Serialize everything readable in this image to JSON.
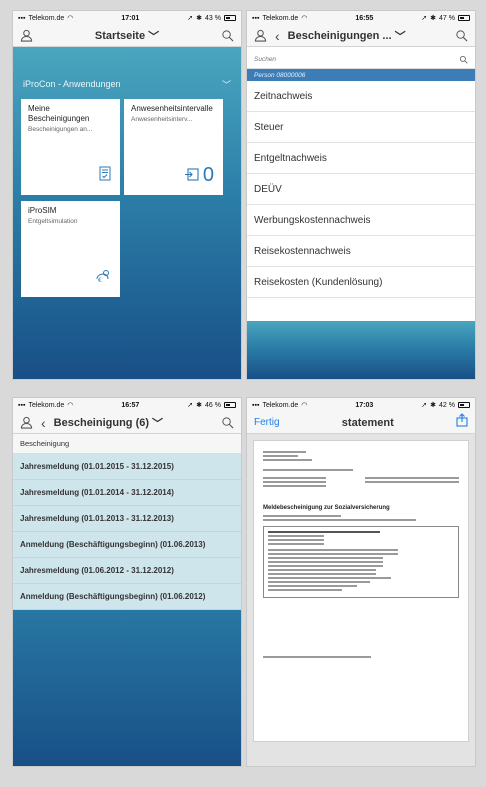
{
  "screens": [
    {
      "status": {
        "carrier": "Telekom.de",
        "time": "17:01",
        "battery": "43 %"
      },
      "nav": {
        "title": "Startseite"
      },
      "group": {
        "title": "iProCon - Anwendungen"
      },
      "tiles": [
        {
          "title": "Meine Bescheinigungen",
          "subtitle": "Bescheinigungen an...",
          "icon": "document-check-icon"
        },
        {
          "title": "Anwesenheitsintervalle",
          "subtitle": "Anwesenheitsinterv...",
          "icon": "import-icon",
          "count": "0"
        },
        {
          "title": "iProSIM",
          "subtitle": "Entgeltsimulation",
          "icon": "money-simulation-icon"
        }
      ]
    },
    {
      "status": {
        "carrier": "Telekom.de",
        "time": "16:55",
        "battery": "47 %"
      },
      "nav": {
        "title": "Bescheinigungen ..."
      },
      "search": {
        "placeholder": "Suchen"
      },
      "person": "Person 08000006",
      "items": [
        "Zeitnachweis",
        "Steuer",
        "Entgeltnachweis",
        "DEÜV",
        "Werbungskostennachweis",
        "Reisekostennachweis",
        "Reisekosten (Kundenlösung)"
      ]
    },
    {
      "status": {
        "carrier": "Telekom.de",
        "time": "16:57",
        "battery": "46 %"
      },
      "nav": {
        "title": "Bescheinigung (6)"
      },
      "header": "Bescheinigung",
      "entries": [
        "Jahresmeldung (01.01.2015 - 31.12.2015)",
        "Jahresmeldung (01.01.2014 - 31.12.2014)",
        "Jahresmeldung (01.01.2013 - 31.12.2013)",
        "Anmeldung (Beschäftigungsbeginn) (01.06.2013)",
        "Jahresmeldung (01.06.2012 - 31.12.2012)",
        "Anmeldung (Beschäftigungsbeginn) (01.06.2012)"
      ]
    },
    {
      "status": {
        "carrier": "Telekom.de",
        "time": "17:03",
        "battery": "42 %"
      },
      "nav": {
        "done": "Fertig",
        "title": "statement"
      },
      "doc": {
        "heading": "Meldebescheinigung zur Sozialversicherung"
      }
    }
  ],
  "colors": {
    "accent_blue": "#1e7ee6",
    "tile_icon": "#2a7ab8",
    "person_bar": "#3c7db7",
    "list_highlight": "#cfe5ec"
  }
}
